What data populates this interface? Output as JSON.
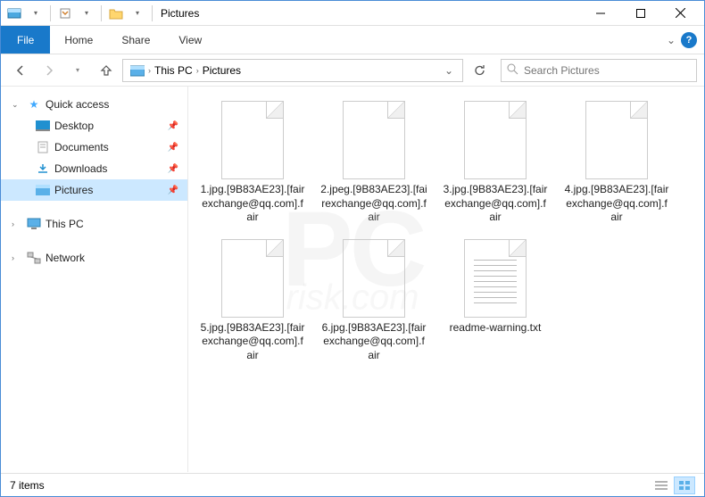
{
  "title": "Pictures",
  "ribbon": {
    "file": "File",
    "home": "Home",
    "share": "Share",
    "view": "View"
  },
  "breadcrumb": {
    "root": "This PC",
    "current": "Pictures"
  },
  "search": {
    "placeholder": "Search Pictures"
  },
  "sidebar": {
    "quick": "Quick access",
    "desktop": "Desktop",
    "documents": "Documents",
    "downloads": "Downloads",
    "pictures": "Pictures",
    "thispc": "This PC",
    "network": "Network"
  },
  "files": [
    {
      "name": "1.jpg.[9B83AE23].[fairexchange@qq.com].fair",
      "type": "file"
    },
    {
      "name": "2.jpeg.[9B83AE23].[fairexchange@qq.com].fair",
      "type": "file"
    },
    {
      "name": "3.jpg.[9B83AE23].[fairexchange@qq.com].fair",
      "type": "file"
    },
    {
      "name": "4.jpg.[9B83AE23].[fairexchange@qq.com].fair",
      "type": "file"
    },
    {
      "name": "5.jpg.[9B83AE23].[fairexchange@qq.com].fair",
      "type": "file"
    },
    {
      "name": "6.jpg.[9B83AE23].[fairexchange@qq.com].fair",
      "type": "file"
    },
    {
      "name": "readme-warning.txt",
      "type": "txt"
    }
  ],
  "status": {
    "count": "7 items"
  }
}
